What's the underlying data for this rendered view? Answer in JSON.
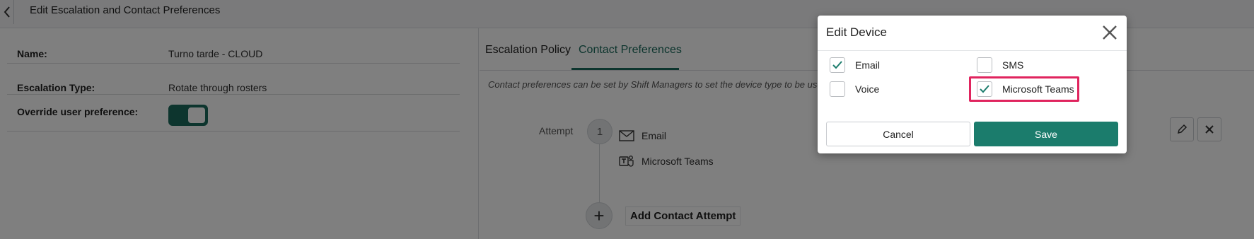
{
  "header": {
    "title": "Edit Escalation and Contact Preferences"
  },
  "form": {
    "name_label": "Name:",
    "name_value": "Turno tarde - CLOUD",
    "type_label": "Escalation Type:",
    "type_value": "Rotate through rosters",
    "override_label": "Override user preference:",
    "override_on": true
  },
  "tabs": [
    {
      "label": "Escalation Policy",
      "active": false
    },
    {
      "label": "Contact Preferences",
      "active": true
    }
  ],
  "note": "Contact preferences can be set by Shift Managers to set the device type to be use",
  "attempt": {
    "label": "Attempt",
    "number": "1",
    "devices": [
      {
        "name": "Email",
        "icon": "envelope-icon"
      },
      {
        "name": "Microsoft Teams",
        "icon": "teams-icon"
      }
    ],
    "add_label": "Add Contact Attempt"
  },
  "dialog": {
    "title": "Edit Device",
    "options": [
      {
        "label": "Email",
        "checked": true
      },
      {
        "label": "SMS",
        "checked": false
      },
      {
        "label": "Voice",
        "checked": false
      },
      {
        "label": "Microsoft Teams",
        "checked": true
      }
    ],
    "cancel_label": "Cancel",
    "save_label": "Save"
  },
  "colors": {
    "accent": "#1b7c6c",
    "highlight": "#e0245e"
  }
}
